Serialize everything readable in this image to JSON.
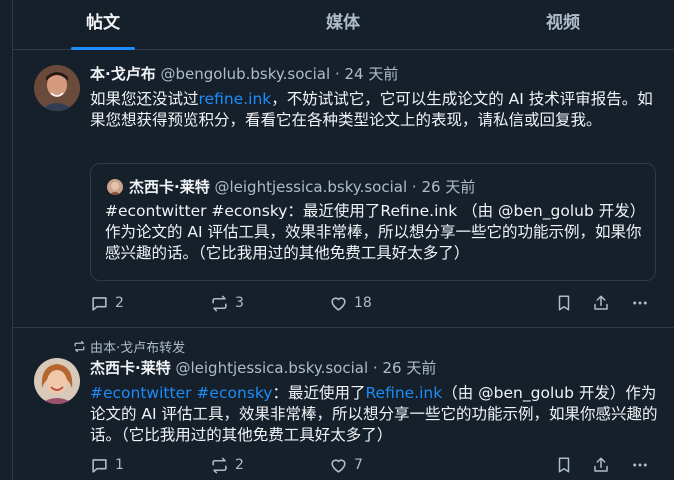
{
  "tabs": [
    {
      "label": "帖文",
      "active": true
    },
    {
      "label": "媒体",
      "active": false
    },
    {
      "label": "视频",
      "active": false
    }
  ],
  "colors": {
    "background": "#15202b",
    "accent": "#1d8cf8",
    "muted": "#aebbc9",
    "border": "#2c3a4a"
  },
  "post1": {
    "author": "本·戈卢布",
    "handle": "@bengolub.bsky.social",
    "separator": "·",
    "time": "24 天前",
    "body_pre": "如果您还没试过",
    "body_link": "refine.ink",
    "body_post": "，不妨试试它，它可以生成论文的 AI 技术评审报告。如果您想获得预览积分，看看它在各种类型论文上的表现，请私信或回复我。",
    "quote": {
      "author": "杰西卡·莱特",
      "handle": "@leightjessica.bsky.social",
      "separator": "·",
      "time": "26 天前",
      "body": "#econtwitter  #econsky：最近使用了Refine.ink （由 @ben_golub 开发）作为论文的 AI 评估工具，效果非常棒，所以想分享一些它的功能示例，如果你感兴趣的话。（它比我用过的其他免费工具好太多了）"
    },
    "actions": {
      "replies": "2",
      "reposts": "3",
      "likes": "18"
    }
  },
  "post2": {
    "repost_note": "由本·戈卢布转发",
    "author": "杰西卡·莱特",
    "handle": "@leightjessica.bsky.social",
    "separator": "·",
    "time": "26 天前",
    "tag1": "#econtwitter",
    "tag2": "#econsky",
    "body_mid": "：最近使用了",
    "body_link": "Refine.ink",
    "body_post": "（由 @ben_golub 开发）作为论文的 AI 评估工具，效果非常棒，所以想分享一些它的功能示例，如果你感兴趣的话。（它比我用过的其他免费工具好太多了）",
    "actions": {
      "replies": "1",
      "reposts": "2",
      "likes": "7"
    }
  }
}
